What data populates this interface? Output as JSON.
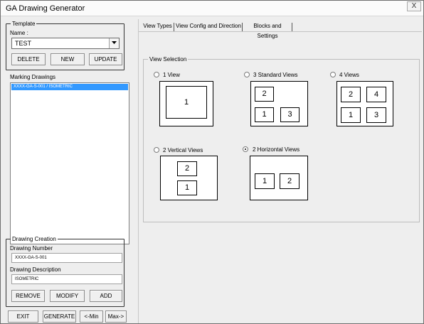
{
  "window": {
    "title": "GA Drawing Generator",
    "close_glyph": "X"
  },
  "template": {
    "legend": "Template",
    "name_label": "Name :",
    "name_value": "TEST",
    "delete_label": "DELETE",
    "new_label": "NEW",
    "update_label": "UPDATE"
  },
  "marking": {
    "label": "Marking Drawings",
    "items": [
      "XXXX-GA-S-001 / ISOMETRIC"
    ]
  },
  "creation": {
    "legend": "Drawing Creation",
    "number_label": "Drawing Number",
    "number_value": "XXXX-GA-S-001",
    "description_label": "Drawing Description",
    "description_value": "ISOMETRIC",
    "remove_label": "REMOVE",
    "modify_label": "MODIFY",
    "add_label": "ADD"
  },
  "footer": {
    "exit_label": "EXIT",
    "generate_label": "GENERATE",
    "min_label": "<-Min",
    "max_label": "Max->"
  },
  "tabs": [
    "View Types",
    "View Config and Direction",
    "Blocks and Settings"
  ],
  "active_tab": "View Types",
  "view_selection": {
    "legend": "View Selection",
    "options": [
      {
        "label": "1 View",
        "selected": false,
        "boxes": [
          "1"
        ]
      },
      {
        "label": "3 Standard Views",
        "selected": false,
        "boxes": [
          "2",
          "1",
          "3"
        ]
      },
      {
        "label": "4 Views",
        "selected": false,
        "boxes": [
          "2",
          "4",
          "1",
          "3"
        ]
      },
      {
        "label": "2 Vertical Views",
        "selected": false,
        "boxes": [
          "2",
          "1"
        ]
      },
      {
        "label": "2 Horizontal Views",
        "selected": true,
        "boxes": [
          "1",
          "2"
        ]
      }
    ]
  },
  "colors": {
    "selection_bg": "#3399ff",
    "window_bg": "#eeeeee"
  }
}
